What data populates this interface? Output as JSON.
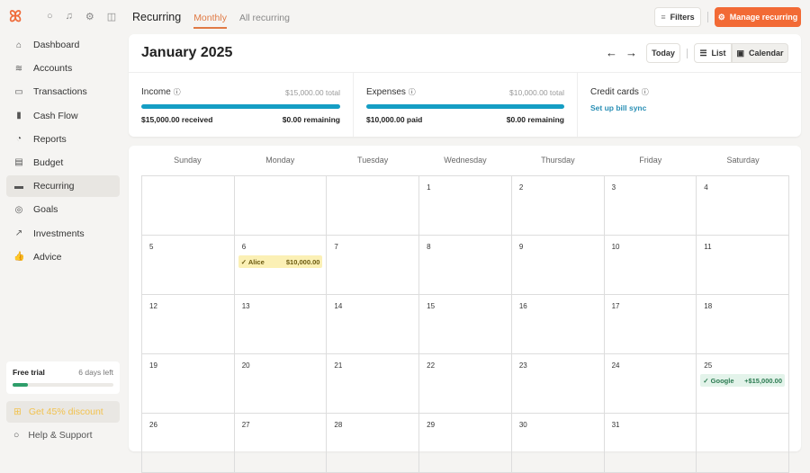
{
  "sidebar": {
    "items": [
      {
        "label": "Dashboard",
        "icon": "home-icon",
        "glyph": "⌂"
      },
      {
        "label": "Accounts",
        "icon": "layers-icon",
        "glyph": "≋"
      },
      {
        "label": "Transactions",
        "icon": "card-icon",
        "glyph": "▭"
      },
      {
        "label": "Cash Flow",
        "icon": "bar-chart-icon",
        "glyph": "▮"
      },
      {
        "label": "Reports",
        "icon": "pie-chart-icon",
        "glyph": "◔"
      },
      {
        "label": "Budget",
        "icon": "map-icon",
        "glyph": "▤"
      },
      {
        "label": "Recurring",
        "icon": "calendar-stack-icon",
        "glyph": "▬"
      },
      {
        "label": "Goals",
        "icon": "target-icon",
        "glyph": "◎"
      },
      {
        "label": "Investments",
        "icon": "trend-up-icon",
        "glyph": "↗"
      },
      {
        "label": "Advice",
        "icon": "thumbs-up-icon",
        "glyph": "👍"
      }
    ],
    "trial": {
      "label": "Free trial",
      "days": "6 days left",
      "progress": 0.15
    },
    "discount": "Get 45% discount",
    "help": "Help & Support"
  },
  "header": {
    "title": "Recurring",
    "tabs": [
      "Monthly",
      "All recurring"
    ],
    "filters": "Filters",
    "manage": "Manage recurring"
  },
  "calendar": {
    "month": "January 2025",
    "today": "Today",
    "list": "List",
    "calendar": "Calendar",
    "income": {
      "label": "Income",
      "total": "$15,000.00 total",
      "left": "$15,000.00 received",
      "right": "$0.00 remaining",
      "progress": 1
    },
    "expenses": {
      "label": "Expenses",
      "total": "$10,000.00 total",
      "left": "$10,000.00 paid",
      "right": "$0.00 remaining",
      "progress": 1
    },
    "credit": {
      "label": "Credit cards",
      "link": "Set up bill sync"
    },
    "days": [
      "Sunday",
      "Monday",
      "Tuesday",
      "Wednesday",
      "Thursday",
      "Friday",
      "Saturday"
    ],
    "first_weekday": 3,
    "num_days": 31,
    "events": [
      {
        "day": 6,
        "name": "Alice",
        "amount": "$10,000.00",
        "type": "expense"
      },
      {
        "day": 25,
        "name": "Google",
        "amount": "+$15,000.00",
        "type": "income"
      }
    ]
  },
  "colors": {
    "accent": "#ef6b3a",
    "income": "#e3f3ea",
    "expense": "#fbf0b5"
  }
}
